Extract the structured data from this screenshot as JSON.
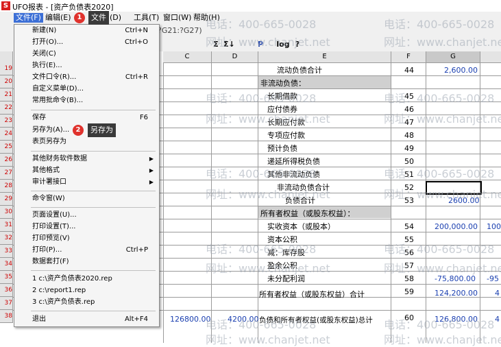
{
  "window": {
    "title": "UFO报表 - [资产负债表2020]"
  },
  "menubar": {
    "items": [
      "文件(F)",
      "编辑(E)",
      "(D)",
      "工具(T)",
      "窗口(W)",
      "帮助(H)"
    ]
  },
  "formula_bar": {
    "text": "?G21:?G27)"
  },
  "toolbar": {
    "icons": [
      "Σ",
      "Σ↓",
      "P",
      "log",
      "?"
    ]
  },
  "columns": [
    "C",
    "D",
    "E",
    "F",
    "G"
  ],
  "rows": [
    "19",
    "20",
    "21",
    "22",
    "23",
    "24",
    "25",
    "26",
    "27",
    "28",
    "29",
    "30",
    "31",
    "32",
    "33",
    "34",
    "35",
    "36",
    "37",
    "38"
  ],
  "sheet": {
    "cells": [
      {
        "label": "流动负债合计",
        "line": "44",
        "value": "2,600.00"
      },
      {
        "label": "非流动负债：",
        "line": "",
        "value": ""
      },
      {
        "label": "长期借款",
        "line": "45",
        "value": ""
      },
      {
        "label": "应付债券",
        "line": "46",
        "value": ""
      },
      {
        "label": "长期应付款",
        "line": "47",
        "value": ""
      },
      {
        "label": "专项应付款",
        "line": "48",
        "value": ""
      },
      {
        "label": "预计负债",
        "line": "49",
        "value": ""
      },
      {
        "label": "递延所得税负债",
        "line": "50",
        "value": ""
      },
      {
        "label": "其他非流动负债",
        "line": "51",
        "value": ""
      },
      {
        "label": "非流动负债合计",
        "line": "52",
        "value": ""
      },
      {
        "label": "负债合计",
        "line": "53",
        "value": "2600.00"
      },
      {
        "label": "所有者权益（或股东权益）：",
        "line": "",
        "value": ""
      },
      {
        "label": "实收资本（或股本）",
        "line": "54",
        "value": "200,000.00",
        "extra": "100"
      },
      {
        "label": "资本公积",
        "line": "55",
        "value": ""
      },
      {
        "label": "减：库存股",
        "line": "56",
        "value": ""
      },
      {
        "label": "盈余公积",
        "line": "57",
        "value": ""
      },
      {
        "label": "未分配利润",
        "line": "58",
        "value": "-75,800.00",
        "extra": "-95"
      },
      {
        "label": "所有者权益（或股东权益）合计",
        "line": "59",
        "value": "124,200.00",
        "extra": "4"
      },
      {
        "label": "负债和所有者权益(或股东权益)总计",
        "line": "60",
        "value": "126,800.00",
        "extra": "4",
        "c": "126800.00",
        "d": "4200.00"
      }
    ]
  },
  "watermarks": {
    "phone": "电话：400-665-0028",
    "site": "网址：www.chanjet.net"
  },
  "file_menu": {
    "items": [
      {
        "label": "新建(N)",
        "shortcut": "Ctrl+N"
      },
      {
        "label": "打开(O)...",
        "shortcut": "Ctrl+O"
      },
      {
        "label": "关闭(C)",
        "shortcut": ""
      },
      {
        "label": "执行(E)...",
        "shortcut": ""
      },
      {
        "label": "文件口令(R)...",
        "shortcut": "Ctrl+R"
      },
      {
        "label": "自定义菜单(D)...",
        "shortcut": ""
      },
      {
        "label": "常用批命令(B)...",
        "shortcut": ""
      },
      {
        "label": "保存",
        "shortcut": "F6"
      },
      {
        "label": "另存为(A)...",
        "shortcut": ""
      },
      {
        "label": "表页另存为",
        "shortcut": ""
      },
      {
        "label": "其他财务软件数据",
        "shortcut": "",
        "submenu": true
      },
      {
        "label": "其他格式",
        "shortcut": "",
        "submenu": true
      },
      {
        "label": "审计署接口",
        "shortcut": "",
        "submenu": true
      },
      {
        "label": "命令窗(W)",
        "shortcut": ""
      },
      {
        "label": "页面设置(U)...",
        "shortcut": ""
      },
      {
        "label": "打印设置(T)...",
        "shortcut": ""
      },
      {
        "label": "打印预览(V)",
        "shortcut": ""
      },
      {
        "label": "打印(P)...",
        "shortcut": "Ctrl+P"
      },
      {
        "label": "数据套打(F)",
        "shortcut": ""
      },
      {
        "label": "1 c:\\资产负债表2020.rep",
        "shortcut": ""
      },
      {
        "label": "2 c:\\report1.rep",
        "shortcut": ""
      },
      {
        "label": "3 c:\\资产负债表.rep",
        "shortcut": ""
      },
      {
        "label": "退出",
        "shortcut": "Alt+F4"
      }
    ]
  },
  "annotations": [
    {
      "number": "1",
      "text": "文件"
    },
    {
      "number": "2",
      "text": "另存为"
    }
  ],
  "colors": {
    "accent": "#3c6fd6",
    "badge": "#e0322d",
    "value_text": "#1a3fb0"
  }
}
